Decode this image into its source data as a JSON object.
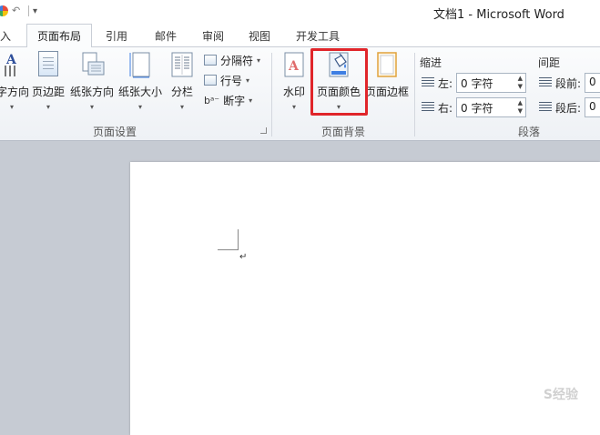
{
  "window": {
    "title": "文档1 - Microsoft Word"
  },
  "quick_access": {
    "items": [
      "office-logo-icon",
      "undo-icon",
      "customize-qat-icon"
    ]
  },
  "tabs": [
    {
      "label": "入"
    },
    {
      "label": "页面布局",
      "active": true
    },
    {
      "label": "引用"
    },
    {
      "label": "邮件"
    },
    {
      "label": "审阅"
    },
    {
      "label": "视图"
    },
    {
      "label": "开发工具"
    }
  ],
  "ribbon": {
    "page_setup": {
      "label": "页面设置",
      "buttons": {
        "text_direction": "字方向",
        "margins": "页边距",
        "orientation": "纸张方向",
        "size": "纸张大小",
        "columns": "分栏"
      },
      "small_buttons": {
        "breaks": "分隔符",
        "line_numbers": "行号",
        "hyphenation": "断字"
      }
    },
    "page_background": {
      "label": "页面背景",
      "buttons": {
        "watermark": "水印",
        "page_color": "页面颜色",
        "page_borders": "页面边框"
      }
    },
    "paragraph": {
      "label": "段落",
      "indent_title": "缩进",
      "spacing_title": "间距",
      "left_label": "左:",
      "left_value": "0 字符",
      "right_label": "右:",
      "right_value": "0 字符",
      "before_label": "段前:",
      "after_label": "段后:",
      "before_value": "0",
      "after_value": "0"
    }
  },
  "document": {
    "paragraph_mark": "↵"
  },
  "watermark": "S经验"
}
